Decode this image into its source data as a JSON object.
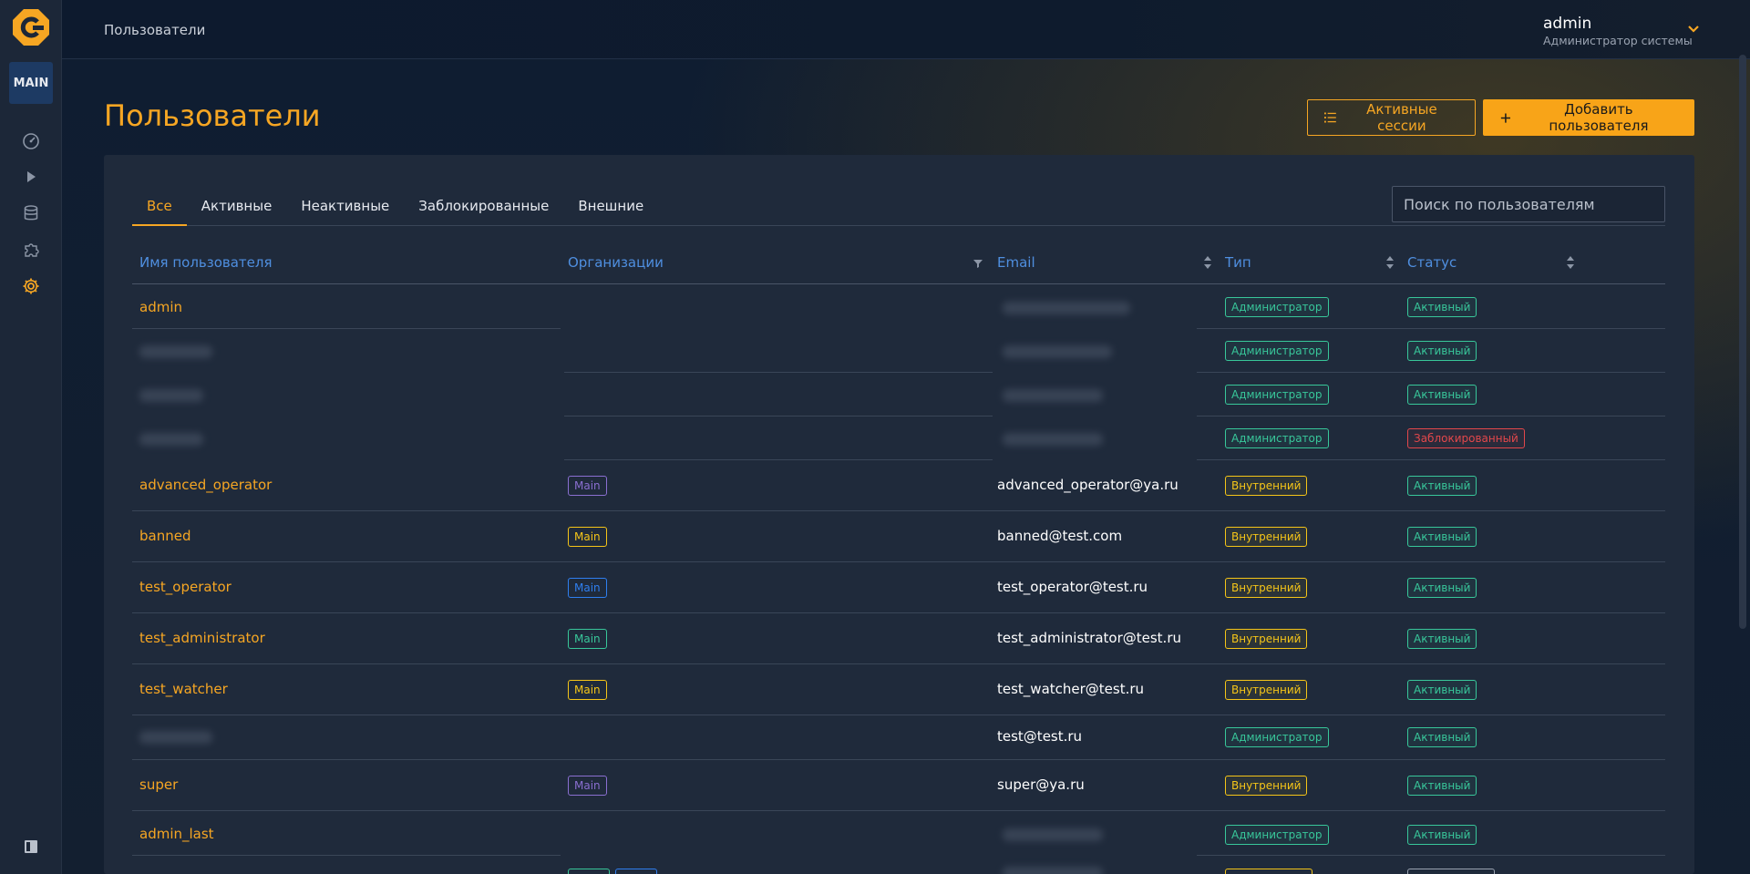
{
  "sidebar": {
    "workspace": "MAIN",
    "items": [
      {
        "icon": "dashboard-icon"
      },
      {
        "icon": "play-icon"
      },
      {
        "icon": "database-icon"
      },
      {
        "icon": "puzzle-icon"
      },
      {
        "icon": "gear-icon",
        "active": true
      }
    ]
  },
  "header": {
    "breadcrumb": "Пользователи",
    "user": {
      "name": "admin",
      "role": "Администратор системы"
    }
  },
  "page": {
    "title": "Пользователи",
    "sessions_button": "Активные сессии",
    "add_button": "Добавить пользователя"
  },
  "tabs": [
    "Все",
    "Активные",
    "Неактивные",
    "Заблокированные",
    "Внешние"
  ],
  "search": {
    "placeholder": "Поиск по пользователям",
    "value": ""
  },
  "table": {
    "columns": {
      "username": "Имя пользователя",
      "orgs": "Организации",
      "email": "Email",
      "type": "Тип",
      "status": "Статус"
    },
    "rows": [
      {
        "username": "admin",
        "org": "",
        "email": "",
        "type": "Администратор",
        "status": "Активный"
      },
      {
        "username": "",
        "org": "",
        "email": "",
        "type": "Администратор",
        "status": "Активный"
      },
      {
        "username": "",
        "org": "",
        "email": "",
        "type": "Администратор",
        "status": "Активный"
      },
      {
        "username": "",
        "org": "",
        "email": "",
        "type": "Администратор",
        "status": "Заблокированный"
      },
      {
        "username": "advanced_operator",
        "org": "Main",
        "email": "advanced_operator@ya.ru",
        "type": "Внутренний",
        "status": "Активный"
      },
      {
        "username": "banned",
        "org": "Main",
        "email": "banned@test.com",
        "type": "Внутренний",
        "status": "Активный"
      },
      {
        "username": "test_operator",
        "org": "Main",
        "email": "test_operator@test.ru",
        "type": "Внутренний",
        "status": "Активный"
      },
      {
        "username": "test_administrator",
        "org": "Main",
        "email": "test_administrator@test.ru",
        "type": "Внутренний",
        "status": "Активный"
      },
      {
        "username": "test_watcher",
        "org": "Main",
        "email": "test_watcher@test.ru",
        "type": "Внутренний",
        "status": "Активный"
      },
      {
        "username": "",
        "org": "",
        "email": "test@test.ru",
        "type": "Администратор",
        "status": "Активный"
      },
      {
        "username": "super",
        "org": "Main",
        "email": "super@ya.ru",
        "type": "Внутренний",
        "status": "Активный"
      },
      {
        "username": "admin_last",
        "org": "",
        "email": "",
        "type": "Администратор",
        "status": "Активный"
      }
    ]
  },
  "colors": {
    "accent": "#f6a623",
    "link": "#4f8fe0",
    "active": "#38c79a",
    "internal": "#f5c518",
    "blocked": "#e2474b"
  }
}
